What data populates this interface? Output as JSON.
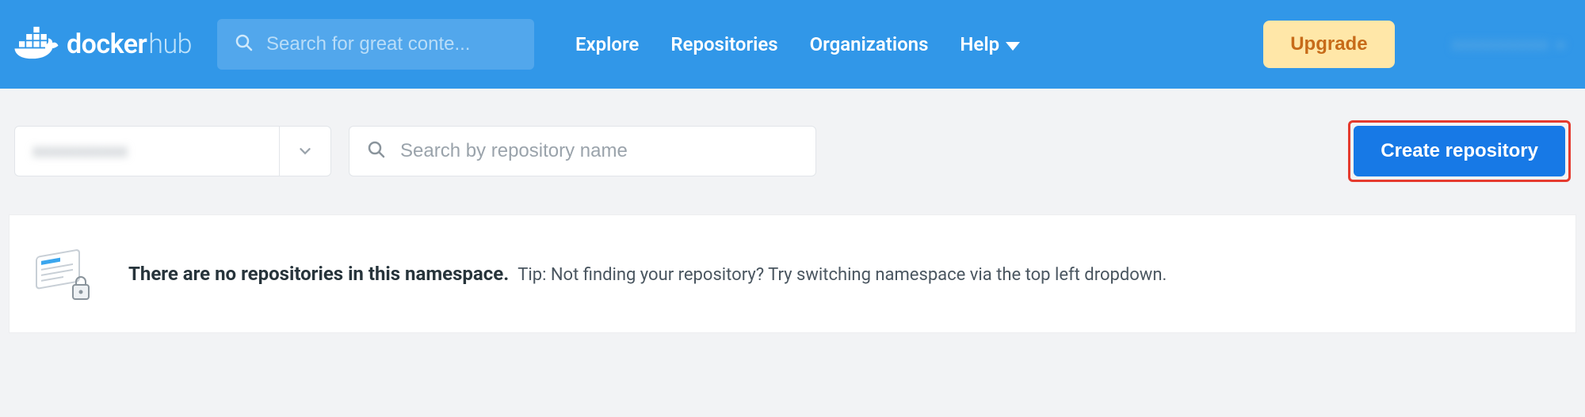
{
  "brand": {
    "name": "docker",
    "suffix": "hub"
  },
  "global_search": {
    "placeholder": "Search for great conte..."
  },
  "nav": {
    "explore": "Explore",
    "repositories": "Repositories",
    "organizations": "Organizations",
    "help": "Help"
  },
  "upgrade_label": "Upgrade",
  "user": {
    "name_masked": "xxxxxxxxxxx"
  },
  "toolbar": {
    "namespace_masked": "xxxxxxxxxxx",
    "repo_search_placeholder": "Search by repository name",
    "create_label": "Create repository"
  },
  "empty_state": {
    "headline": "There are no repositories in this namespace.",
    "tip": "Tip: Not finding your repository? Try switching namespace via the top left dropdown."
  }
}
